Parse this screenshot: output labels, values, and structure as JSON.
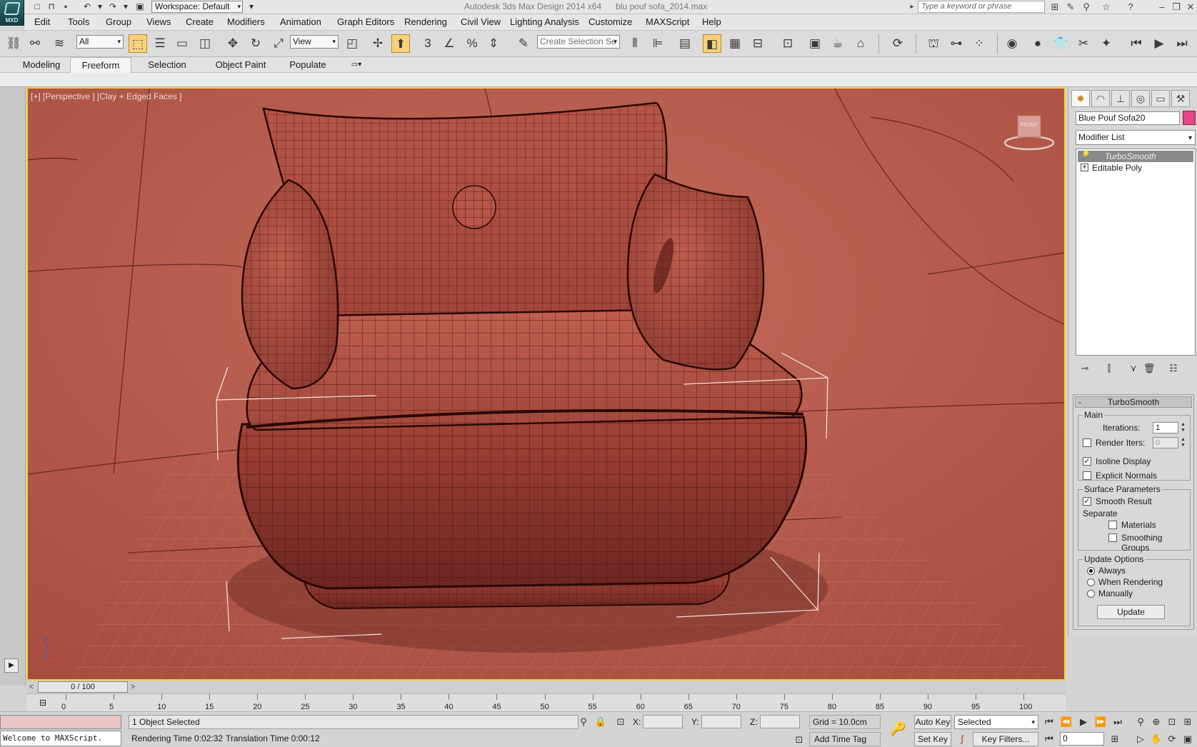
{
  "title_bar": {
    "workspace": "Workspace: Default",
    "app_title": "Autodesk 3ds Max Design 2014 x64",
    "file_name": "blu pouf sofa_2014.max",
    "search_placeholder": "Type a keyword or phrase",
    "logo_text": "MXD"
  },
  "menu": [
    "Edit",
    "Tools",
    "Group",
    "Views",
    "Create",
    "Modifiers",
    "Animation",
    "Graph Editors",
    "Rendering",
    "Civil View",
    "Lighting Analysis",
    "Customize",
    "MAXScript",
    "Help"
  ],
  "toolbar": {
    "selection_filter": "All",
    "reference_coord": "View",
    "selection_set_placeholder": "Create Selection Se",
    "snap_label": "3",
    "angle_snap": "%"
  },
  "ribbon": {
    "tabs": [
      "Modeling",
      "Freeform",
      "Selection",
      "Object Paint",
      "Populate"
    ],
    "active_tab": "Freeform"
  },
  "viewport": {
    "label": "[+] [Perspective ] [Clay + Edged Faces ]",
    "viewcube_label": "FRONT",
    "axis_z": "z",
    "axis_x": "x",
    "background_color": "#b75a4c",
    "border_color": "#f2d232"
  },
  "command_panel": {
    "object_name": "Blue Pouf Sofa20",
    "object_color": "#e8448a",
    "modifier_list_label": "Modifier List",
    "stack": [
      {
        "label": "TurboSmooth",
        "selected": true,
        "icon": "lightbulb-icon"
      },
      {
        "label": "Editable Poly",
        "selected": false,
        "icon": "plus-icon"
      }
    ],
    "rollout": {
      "title": "TurboSmooth",
      "main_group": "Main",
      "iterations_label": "Iterations:",
      "iterations_value": "1",
      "render_iters_label": "Render Iters:",
      "render_iters_value": "0",
      "render_iters_checked": false,
      "isoline_label": "Isoline Display",
      "isoline_checked": true,
      "explicit_normals_label": "Explicit Normals",
      "explicit_normals_checked": false,
      "surface_group": "Surface Parameters",
      "smooth_result_label": "Smooth Result",
      "smooth_result_checked": true,
      "separate_label": "Separate",
      "materials_label": "Materials",
      "materials_checked": false,
      "smoothing_groups_label": "Smoothing Groups",
      "smoothing_groups_checked": false,
      "update_group": "Update Options",
      "update_options": [
        "Always",
        "When Rendering",
        "Manually"
      ],
      "update_selected": "Always",
      "update_button": "Update"
    }
  },
  "timeline": {
    "slider_label": "0 / 100",
    "ticks": [
      0,
      5,
      10,
      15,
      20,
      25,
      30,
      35,
      40,
      45,
      50,
      55,
      60,
      65,
      70,
      75,
      80,
      85,
      90,
      95,
      100
    ]
  },
  "status_bar": {
    "maxscript_text": "Welcome to MAXScript.",
    "selection_status": "1 Object Selected",
    "rendering_time": "Rendering Time  0:02:32",
    "translation_time": "Translation Time  0:00:12",
    "coord_x": "X:",
    "coord_y": "Y:",
    "coord_z": "Z:",
    "grid": "Grid = 10.0cm",
    "add_time_tag": "Add Time Tag",
    "auto_key": "Auto Key",
    "set_key": "Set Key",
    "key_mode": "Selected",
    "key_filters": "Key Filters...",
    "frame": "0"
  }
}
